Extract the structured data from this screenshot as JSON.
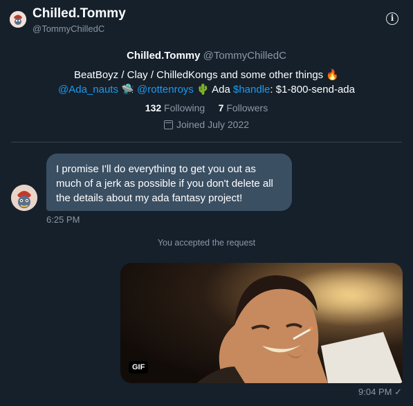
{
  "header": {
    "name": "Chilled.Tommy",
    "handle": "@TommyChilledC",
    "info_icon": "info-icon"
  },
  "profile": {
    "name": "Chilled.Tommy",
    "handle": "@TommyChilledC",
    "bio_line1": "BeatBoyz / Clay / ChilledKongs and some other things 🔥",
    "bio_mention1": "@Ada_nauts",
    "bio_emoji1": "🛸",
    "bio_mention2": "@rottenroys",
    "bio_emoji2": "🌵",
    "bio_word": "Ada",
    "bio_cashtag": "$handle",
    "bio_rest": ": $1-800-send-ada",
    "following_count": "132",
    "following_label": "Following",
    "followers_count": "7",
    "followers_label": "Followers",
    "joined": "Joined July 2022"
  },
  "messages": {
    "received_text": "I promise I'll do everything to get you out as much of a jerk as possible if you don't delete all the details about my ada fantasy project!",
    "received_time": "6:25 PM",
    "system_note": "You accepted the request",
    "gif_label": "GIF",
    "sent_time": "9:04 PM",
    "sent_status": "✓"
  }
}
